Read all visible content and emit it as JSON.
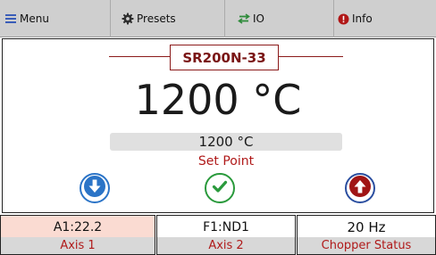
{
  "tabs": {
    "menu": "Menu",
    "presets": "Presets",
    "io": "IO",
    "info": "Info"
  },
  "device": {
    "model": "SR200N-33"
  },
  "temperature": {
    "current": "1200 °C",
    "setpoint_value": "1200 °C",
    "setpoint_label": "Set Point"
  },
  "status": [
    {
      "value": "A1:22.2",
      "label": "Axis 1"
    },
    {
      "value": "F1:ND1",
      "label": "Axis 2"
    },
    {
      "value": "20 Hz",
      "label": "Chopper Status"
    }
  ],
  "colors": {
    "accent_red": "#b01a1a",
    "model_red": "#7a1414",
    "down_blue": "#2b74c7",
    "ok_green": "#2a9a3c",
    "up_red": "#a01515"
  },
  "icons": {
    "menu": "hamburger-icon",
    "presets": "gear-icon",
    "io": "swap-arrows-icon",
    "info": "info-icon",
    "decrease": "arrow-down-icon",
    "confirm": "checkmark-icon",
    "increase": "arrow-up-icon"
  }
}
